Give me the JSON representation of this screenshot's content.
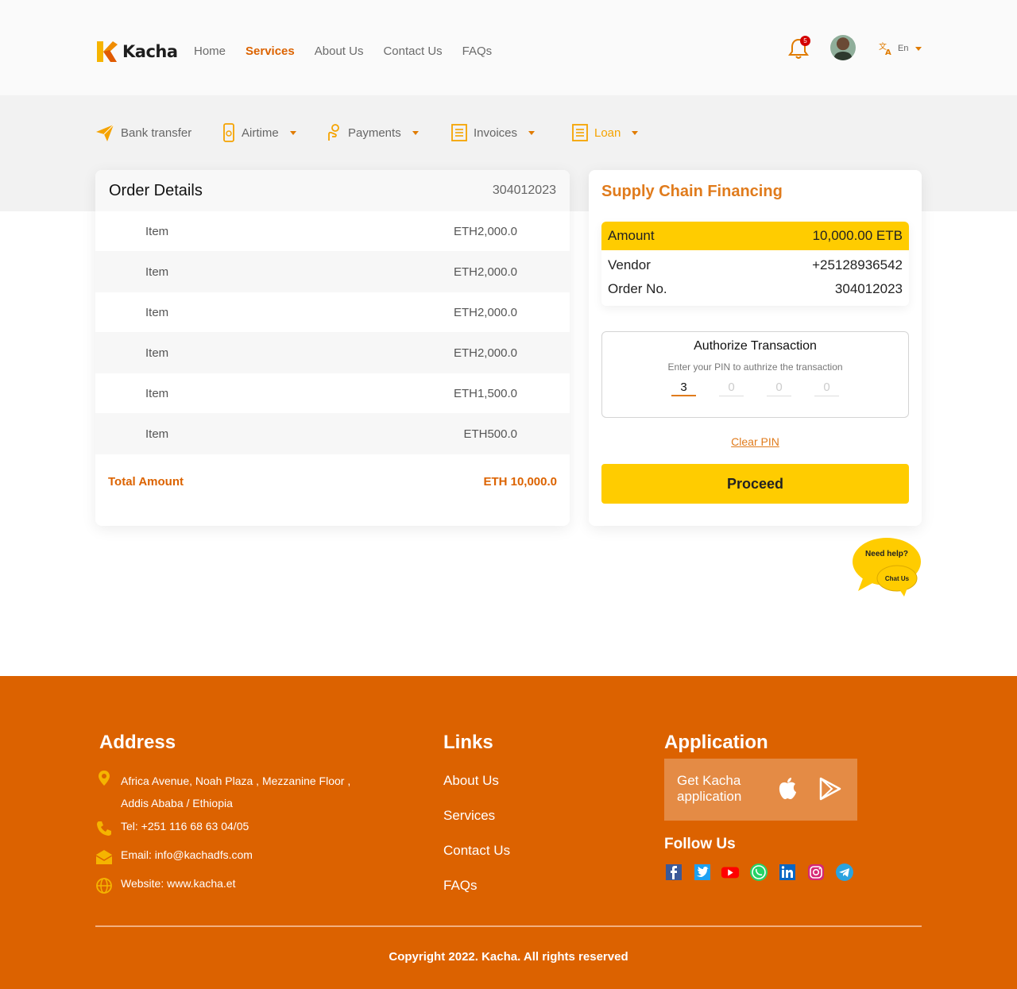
{
  "brand": {
    "name": "Kacha",
    "orange": "#dc6300",
    "yellow": "#ffcc00",
    "logo_icon": "kacha-logo-icon"
  },
  "nav": {
    "items": [
      {
        "label": "Home",
        "active": false
      },
      {
        "label": "Services",
        "active": true
      },
      {
        "label": "About Us",
        "active": false
      },
      {
        "label": "Contact Us",
        "active": false
      },
      {
        "label": "FAQs",
        "active": false
      }
    ]
  },
  "header": {
    "notifications_count": "5",
    "bell_icon": "bell-icon",
    "language": "En",
    "language_icon": "translate-icon"
  },
  "service_tabs": [
    {
      "label": "Bank transfer",
      "icon": "paper-plane-icon",
      "dropdown": false,
      "active": false
    },
    {
      "label": "Airtime",
      "icon": "phone-icon",
      "dropdown": true,
      "active": false
    },
    {
      "label": "Payments",
      "icon": "hand-coin-icon",
      "dropdown": true,
      "active": false
    },
    {
      "label": "Invoices",
      "icon": "invoice-icon",
      "dropdown": true,
      "active": false
    },
    {
      "label": "Loan",
      "icon": "loan-icon",
      "dropdown": true,
      "active": true
    }
  ],
  "order": {
    "title": "Order Details",
    "number": "304012023",
    "items": [
      {
        "name": "Item",
        "amount": "ETH2,000.0"
      },
      {
        "name": "Item",
        "amount": "ETH2,000.0"
      },
      {
        "name": "Item",
        "amount": "ETH2,000.0"
      },
      {
        "name": "Item",
        "amount": "ETH2,000.0"
      },
      {
        "name": "Item",
        "amount": "ETH1,500.0"
      },
      {
        "name": "Item",
        "amount": "ETH500.0"
      }
    ],
    "total_label": "Total Amount",
    "total_value": "ETH 10,000.0"
  },
  "financing": {
    "title": "Supply Chain Financing",
    "amount_label": "Amount",
    "amount_value": "10,000.00 ETB",
    "vendor_label": "Vendor",
    "vendor_value": "+25128936542",
    "order_label": "Order No.",
    "order_value": "304012023"
  },
  "authorize": {
    "title": "Authorize Transaction",
    "subtitle": "Enter your PIN to authrize the transaction",
    "pins": [
      "3",
      "0",
      "0",
      "0"
    ],
    "clear_label": "Clear PIN",
    "proceed_label": "Proceed"
  },
  "help": {
    "line1": "Need help?",
    "line2": "Chat Us"
  },
  "footer": {
    "address_heading": "Address",
    "address_line1": "Africa Avenue, Noah Plaza , Mezzanine Floor ,",
    "address_line2": "Addis Ababa / Ethiopia",
    "tel": "Tel:  +251 116 68 63 04/05",
    "email": "Email: info@kachadfs.com",
    "website": "Website: www.kacha.et",
    "links_heading": "Links",
    "links": [
      "About Us",
      "Services",
      "Contact Us",
      "FAQs"
    ],
    "app_heading": "Application",
    "app_text": "Get Kacha application",
    "follow_heading": "Follow Us",
    "social": [
      "facebook-icon",
      "twitter-icon",
      "youtube-icon",
      "whatsapp-icon",
      "linkedin-icon",
      "instagram-icon",
      "telegram-icon"
    ],
    "copyright": "Copyright 2022. Kacha. All rights reserved"
  }
}
